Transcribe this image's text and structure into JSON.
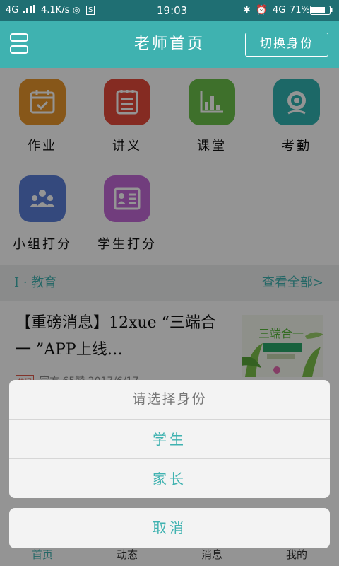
{
  "status_bar": {
    "network": "4G",
    "speed": "4.1K/s",
    "time": "19:03",
    "network_right": "4G",
    "battery": "71%"
  },
  "header": {
    "title": "老师首页",
    "switch_label": "切换身份"
  },
  "grid": [
    {
      "label": "作业",
      "icon": "homework-calendar-icon",
      "color": "#e8962b"
    },
    {
      "label": "讲义",
      "icon": "handout-notepad-icon",
      "color": "#e54a3c"
    },
    {
      "label": "课堂",
      "icon": "classroom-chart-icon",
      "color": "#6cc24a"
    },
    {
      "label": "考勤",
      "icon": "attendance-camera-icon",
      "color": "#31b4b1"
    },
    {
      "label": "小组打分",
      "icon": "group-score-icon",
      "color": "#5b7fd8"
    },
    {
      "label": "学生打分",
      "icon": "student-score-icon",
      "color": "#c36ad8"
    }
  ],
  "section": {
    "title": "I · 教育",
    "view_all": "查看全部>"
  },
  "article": {
    "title": "【重磅消息】12xue “三端合一 ”APP上线…",
    "tag": "热门",
    "meta": "官方 65赞 2017/6/17"
  },
  "bottom_nav": [
    "首页",
    "动态",
    "消息",
    "我的"
  ],
  "dialog": {
    "title": "请选择身份",
    "options": [
      "学生",
      "家长"
    ],
    "cancel": "取消"
  },
  "colors": {
    "accent": "#3fb2b0",
    "status_bar": "#1f6f73"
  }
}
